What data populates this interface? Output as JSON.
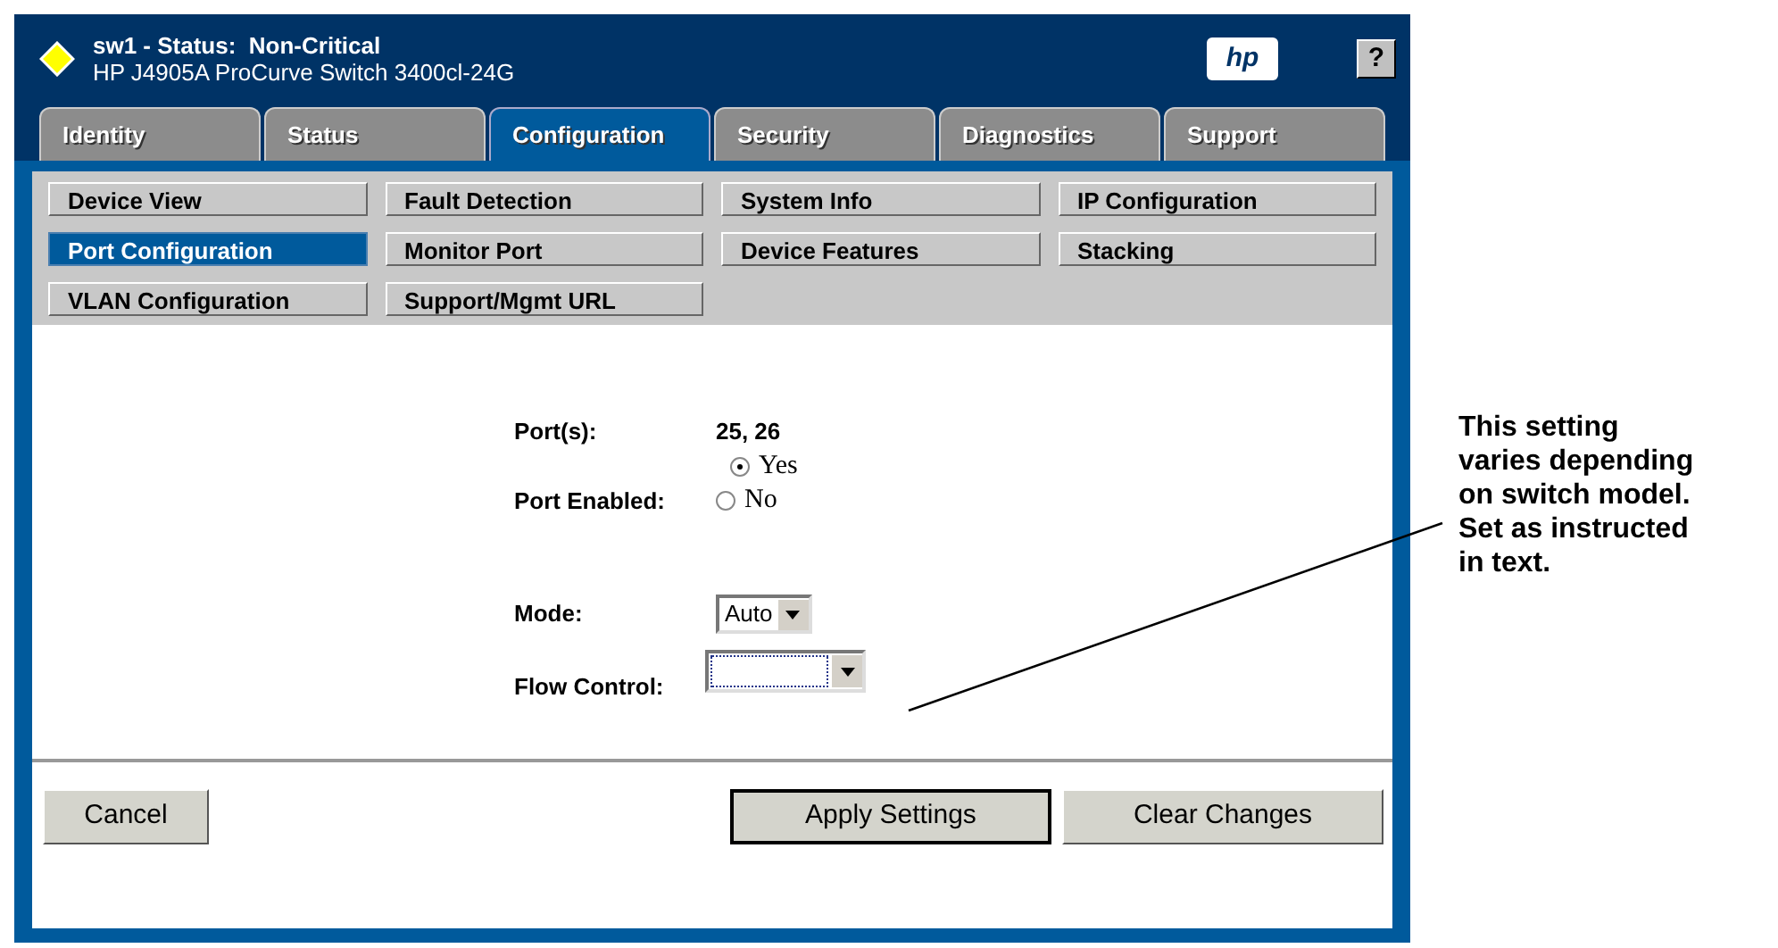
{
  "window": {
    "status_title": "sw1 - Status:  Non-Critical",
    "device": "HP J4905A ProCurve Switch 3400cl-24G",
    "logo": "hp",
    "help": "?"
  },
  "tabs": [
    {
      "label": "Identity",
      "selected": false
    },
    {
      "label": "Status",
      "selected": false
    },
    {
      "label": "Configuration",
      "selected": true
    },
    {
      "label": "Security",
      "selected": false
    },
    {
      "label": "Diagnostics",
      "selected": false
    },
    {
      "label": "Support",
      "selected": false
    }
  ],
  "submenu": [
    {
      "label": "Device View",
      "selected": false
    },
    {
      "label": "Fault Detection",
      "selected": false
    },
    {
      "label": "System Info",
      "selected": false
    },
    {
      "label": "IP Configuration",
      "selected": false
    },
    {
      "label": "Port Configuration",
      "selected": true
    },
    {
      "label": "Monitor Port",
      "selected": false
    },
    {
      "label": "Device Features",
      "selected": false
    },
    {
      "label": "Stacking",
      "selected": false
    },
    {
      "label": "VLAN Configuration",
      "selected": false
    },
    {
      "label": "Support/Mgmt URL",
      "selected": false
    }
  ],
  "form": {
    "ports_label": "Port(s):",
    "ports_value": "25, 26",
    "enabled_label": "Port Enabled:",
    "enabled_options": [
      {
        "label": "Yes",
        "selected": true
      },
      {
        "label": "No",
        "selected": false
      }
    ],
    "mode_label": "Mode:",
    "mode_value": "Auto",
    "flow_label": "Flow Control:"
  },
  "buttons": [
    {
      "label": "Cancel",
      "default": false
    },
    {
      "label": "Apply Settings",
      "default": true
    },
    {
      "label": "Clear Changes",
      "default": false
    }
  ],
  "callout": "This setting\nvaries depending\non switch model.\nSet as instructed\nin text."
}
